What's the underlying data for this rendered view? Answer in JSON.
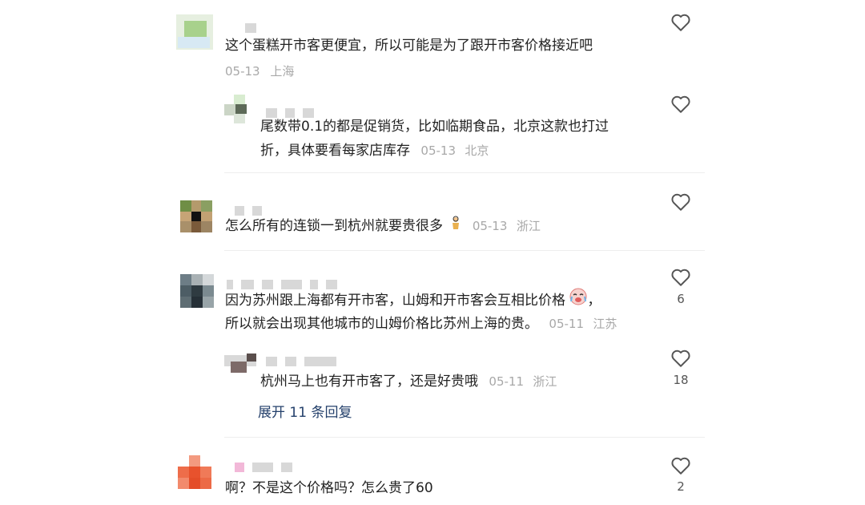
{
  "comments": [
    {
      "text": "这个蛋糕开市客更便宜，所以可能是为了跟开市客价格接近吧",
      "date": "05-13",
      "location": "上海",
      "like_count": ""
    },
    {
      "text_line1": "尾数带0.1的都是促销货，比如临期食品，北京这款也打过",
      "text_line2": "折，具体要看每家店库存",
      "date": "05-13",
      "location": "北京",
      "like_count": ""
    },
    {
      "text": "怎么所有的连锁一到杭州就要贵很多",
      "date": "05-13",
      "location": "浙江",
      "like_count": ""
    },
    {
      "text_line1": "因为苏州跟上海都有开市客，山姆和开市客会互相比价格",
      "text_line2": "所以就会出现其他城市的山姆价格比苏州上海的贵。",
      "date": "05-11",
      "location": "江苏",
      "like_count": "6"
    },
    {
      "text": "杭州马上也有开市客了，还是好贵哦",
      "date": "05-11",
      "location": "浙江",
      "like_count": "18"
    },
    {
      "text": "啊？不是这个价格吗？怎么贵了60",
      "like_count": "2"
    }
  ],
  "expand_replies": "展开 11 条回复",
  "separator": "，",
  "icons": {
    "like": "heart-outline-icon",
    "emoji_person": "person-emoji-icon",
    "emoji_crying": "crying-laugh-emoji-icon"
  },
  "colors": {
    "text": "#222222",
    "meta": "#a8a8a8",
    "link": "#24406b",
    "divider": "#eeeeee"
  }
}
